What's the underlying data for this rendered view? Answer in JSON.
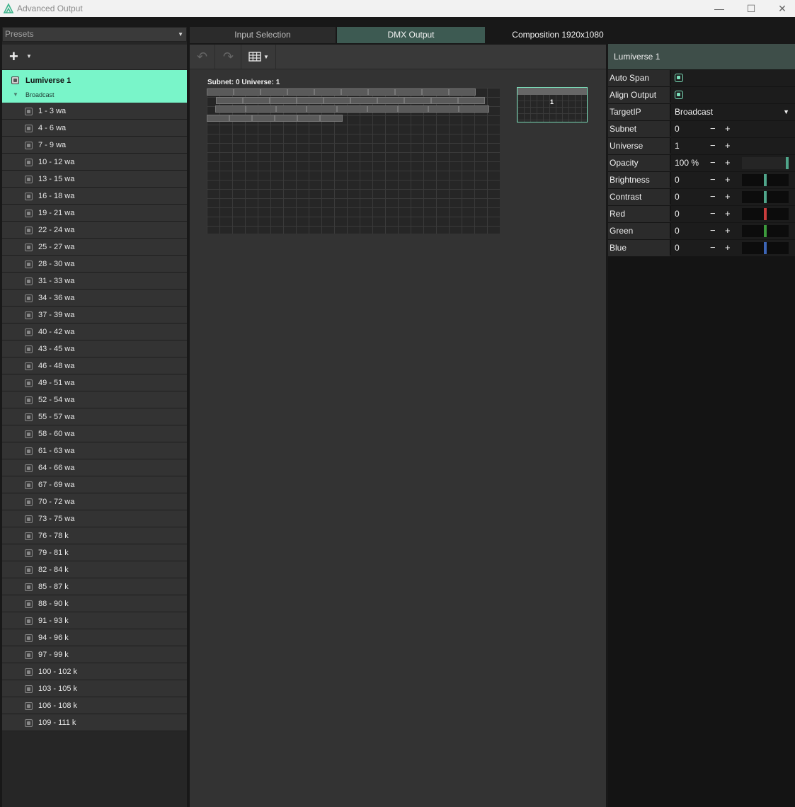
{
  "window": {
    "title": "Advanced Output",
    "minimize": "—",
    "maximize": "☐",
    "close": "✕"
  },
  "left": {
    "presets_label": "Presets",
    "add_symbol": "+",
    "screen": {
      "name": "Lumiverse 1",
      "target": "Broadcast"
    },
    "slices": [
      "1 - 3 wa",
      "4 - 6 wa",
      "7 - 9 wa",
      "10 - 12 wa",
      "13 - 15 wa",
      "16 - 18 wa",
      "19 - 21 wa",
      "22 - 24 wa",
      "25 - 27 wa",
      "28 - 30 wa",
      "31 - 33 wa",
      "34 - 36 wa",
      "37 - 39 wa",
      "40 - 42 wa",
      "43 - 45 wa",
      "46 - 48 wa",
      "49 - 51 wa",
      "52 - 54 wa",
      "55 - 57 wa",
      "58 - 60 wa",
      "61 - 63 wa",
      "64 - 66 wa",
      "67 - 69 wa",
      "70 - 72 wa",
      "73 - 75 wa",
      "76 - 78 k",
      "79 - 81 k",
      "82 - 84 k",
      "85 - 87 k",
      "88 - 90 k",
      "91 - 93 k",
      "94 - 96 k",
      "97 - 99 k",
      "100 - 102 k",
      "103 - 105 k",
      "106 - 108 k",
      "109 - 111 k"
    ]
  },
  "tabs": {
    "input_selection": "Input Selection",
    "dmx_output": "DMX Output",
    "composition": "Composition 1920x1080"
  },
  "center": {
    "canvas_label": "Subnet: 0 Universe: 1",
    "preview_number": "1"
  },
  "right": {
    "header": "Lumiverse 1",
    "rows": {
      "auto_span": {
        "label": "Auto Span",
        "checked": true
      },
      "align_output": {
        "label": "Align Output",
        "checked": true
      },
      "target_ip": {
        "label": "TargetIP",
        "value": "Broadcast"
      },
      "subnet": {
        "label": "Subnet",
        "value": "0"
      },
      "universe": {
        "label": "Universe",
        "value": "1"
      },
      "opacity": {
        "label": "Opacity",
        "value": "100 %"
      },
      "brightness": {
        "label": "Brightness",
        "value": "0"
      },
      "contrast": {
        "label": "Contrast",
        "value": "0"
      },
      "red": {
        "label": "Red",
        "value": "0"
      },
      "green": {
        "label": "Green",
        "value": "0"
      },
      "blue": {
        "label": "Blue",
        "value": "0"
      }
    },
    "minus": "−",
    "plus": "+"
  },
  "colors": {
    "accent": "#79f5c9",
    "red_slider": "#c83c3c",
    "green_slider": "#3c9a3c",
    "blue_slider": "#3c64b4",
    "neutral_slider": "#4fa58a"
  }
}
